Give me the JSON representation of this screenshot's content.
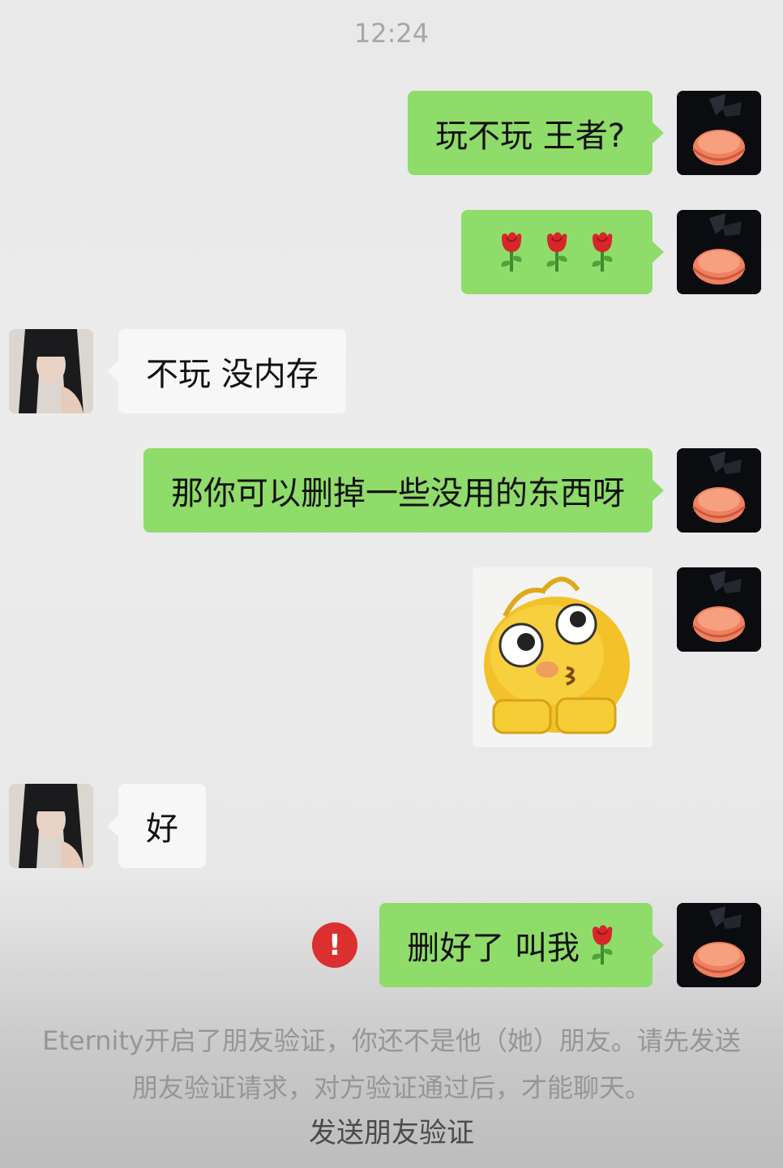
{
  "status_time": "12:24",
  "messages": [
    {
      "text": "玩不玩 王者?"
    },
    {
      "emoji": "rose"
    },
    {
      "text": "不玩 没内存"
    },
    {
      "text": "那你可以删掉一些没用的东西呀"
    },
    {
      "sticker": "yellow-face-emoji-sticker"
    },
    {
      "text": "好"
    },
    {
      "text": "删好了 叫我",
      "emoji": "rose",
      "status": "failed"
    }
  ],
  "error_mark": "!",
  "system_notice": "Eternity开启了朋友验证，你还不是他（她）朋友。请先发送朋友验证请求，对方验证通过后，才能聊天。",
  "verify_link": "发送朋友验证",
  "colors": {
    "outgoing_bubble": "#8fdc6a",
    "incoming_bubble": "#f7f7f7",
    "error": "#dc2f2f"
  }
}
